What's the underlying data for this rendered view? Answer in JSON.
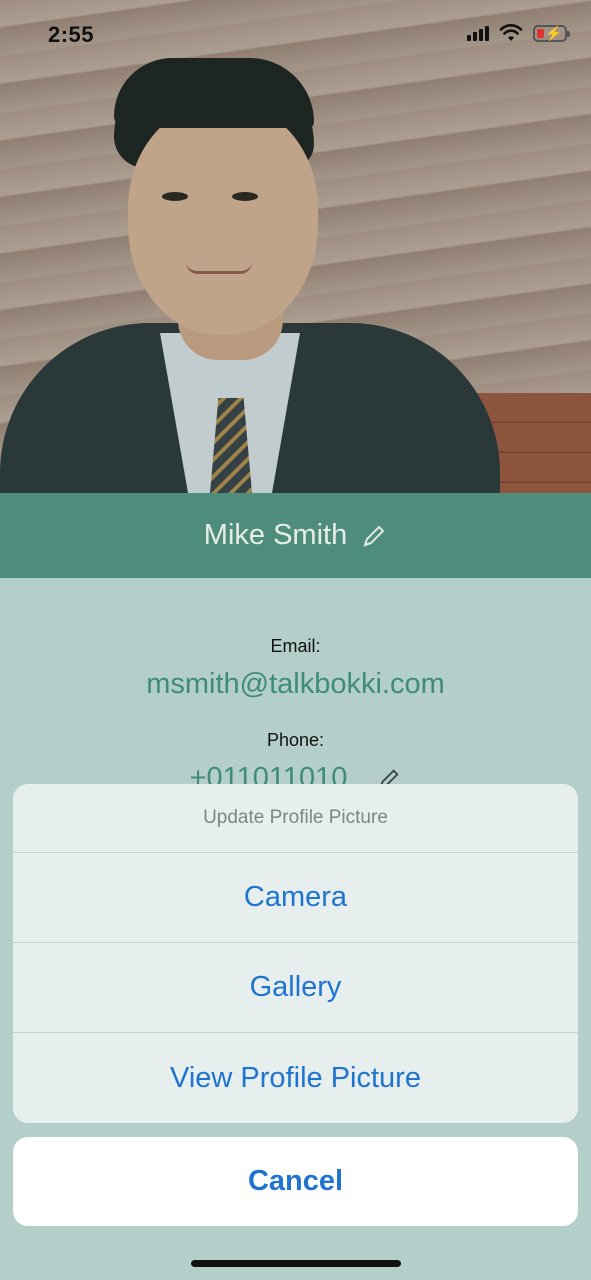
{
  "status_bar": {
    "time": "2:55",
    "signal_icon": "cellular-signal-icon",
    "wifi_icon": "wifi-icon",
    "battery_icon": "battery-charging-low-icon",
    "battery_color": "#e0352c"
  },
  "profile": {
    "name": "Mike Smith",
    "edit_icon": "pencil-icon",
    "photo_subject": "profile-photo",
    "accent_color": "#4e8d7b"
  },
  "info": {
    "email_label": "Email:",
    "email_value": "msmith@talkbokki.com",
    "phone_label": "Phone:",
    "phone_value": "+011011010",
    "value_color": "#3f8c78"
  },
  "action_sheet": {
    "title": "Update Profile Picture",
    "options": [
      {
        "label": "Camera"
      },
      {
        "label": "Gallery"
      },
      {
        "label": "View Profile Picture"
      }
    ],
    "cancel_label": "Cancel",
    "action_color": "#1f74d0"
  }
}
